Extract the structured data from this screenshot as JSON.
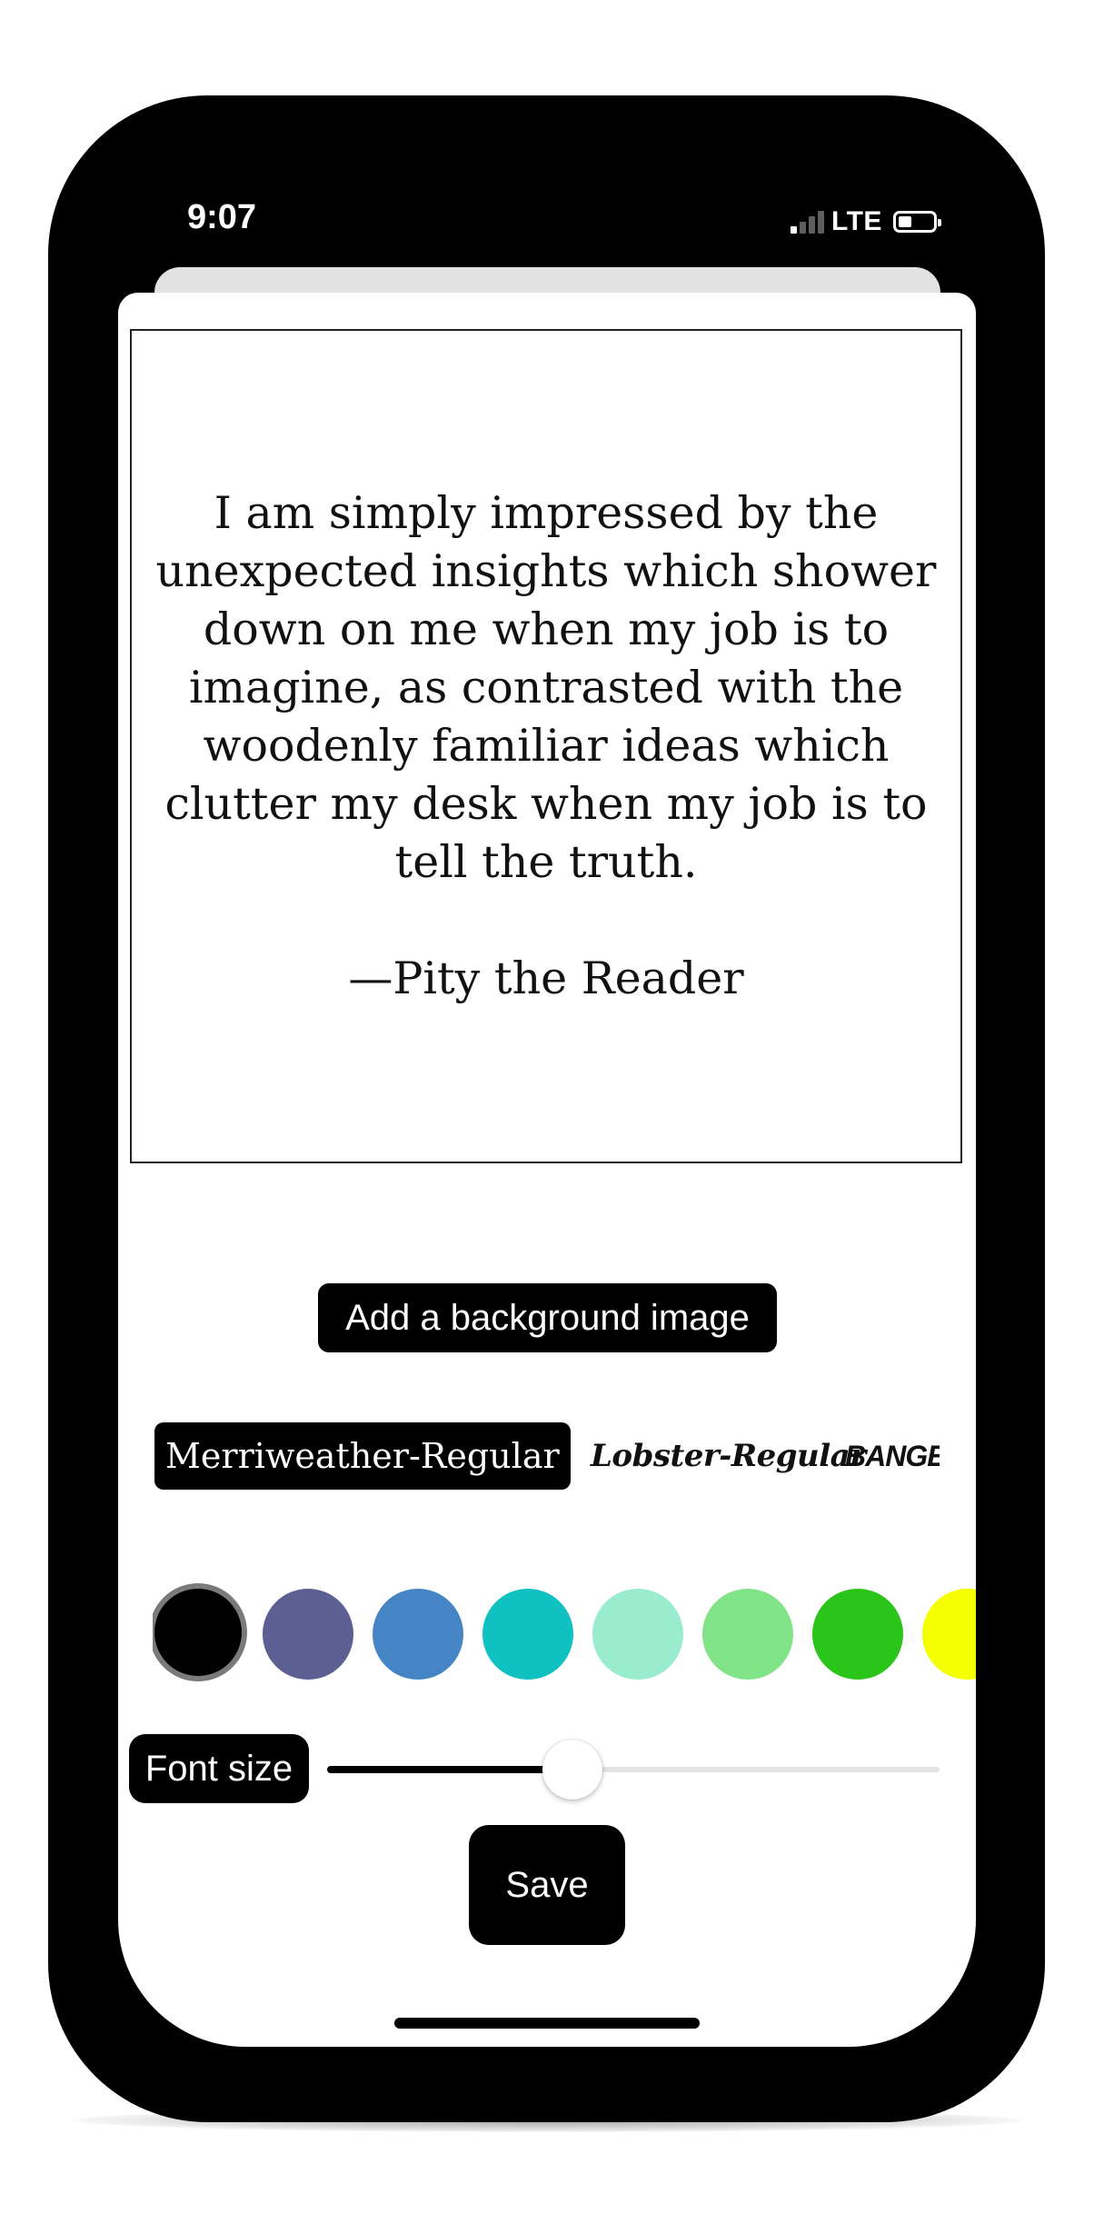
{
  "status_bar": {
    "time": "9:07",
    "network": "LTE",
    "signal_icon": "signal-bars-icon",
    "battery_icon": "battery-icon"
  },
  "quote": {
    "text": "I am simply impressed by the unexpected insights which shower down on me when my job is to imagine, as contrasted with the woodenly familiar ideas which clutter my desk when my job is to tell the truth.",
    "attribution": "—Pity the Reader"
  },
  "add_background_label": "Add a background image",
  "fonts": {
    "items": [
      "Merriweather-Regular",
      "Lobster-Regular",
      "BANGERS"
    ],
    "selected": "Merriweather-Regular"
  },
  "colors": {
    "swatches": [
      "#000000",
      "#5b5f91",
      "#4585c5",
      "#0fc1c1",
      "#9aeccf",
      "#82e489",
      "#2bc41a",
      "#f5ff00"
    ],
    "selected": "#000000"
  },
  "font_size": {
    "label": "Font size",
    "value": 0.4
  },
  "save_label": "Save"
}
